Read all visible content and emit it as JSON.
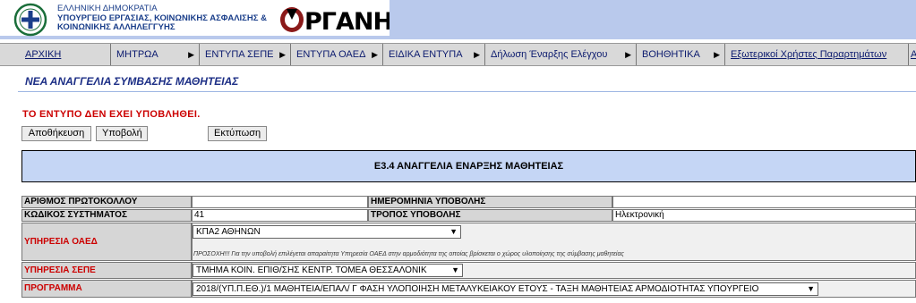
{
  "header": {
    "gov_line1": "ΕΛΛΗΝΙΚΗ ΔΗΜΟΚΡΑΤΙΑ",
    "gov_line2": "ΥΠΟΥΡΓΕΙΟ ΕΡΓΑΣΙΑΣ, ΚΟΙΝΩΝΙΚΗΣ ΑΣΦΑΛΙΣΗΣ &",
    "gov_line3": "ΚΟΙΝΩΝΙΚΗΣ ΑΛΛΗΛΕΓΓΥΗΣ",
    "app_logo": "ΕΡΓΑΝΗ"
  },
  "menu": {
    "items": [
      {
        "label": "ΑΡΧΙΚΗ",
        "arrow": ""
      },
      {
        "label": "ΜΗΤΡΩΑ",
        "arrow": "▶"
      },
      {
        "label": "ΕΝΤΥΠΑ ΣΕΠΕ",
        "arrow": "▶"
      },
      {
        "label": "ΕΝΤΥΠΑ ΟΑΕΔ",
        "arrow": "▶"
      },
      {
        "label": "ΕΙΔΙΚΑ ΕΝΤΥΠΑ",
        "arrow": "▶"
      },
      {
        "label": "Δήλωση Έναρξης Ελέγχου",
        "arrow": "▶"
      },
      {
        "label": "ΒΟΗΘΗΤΙΚΑ",
        "arrow": "▶"
      },
      {
        "label": "Εξωτερικοί Χρήστες Παραρτημάτων",
        "arrow": ""
      },
      {
        "label": "Α",
        "arrow": ""
      }
    ]
  },
  "page": {
    "subtitle": "ΝΕΑ ΑΝΑΓΓΕΛΙΑ ΣΥΜΒΑΣΗΣ ΜΑΘΗΤΕΙΑΣ",
    "warning": "ΤΟ ΕΝΤΥΠΟ ΔΕΝ ΕΧΕΙ ΥΠΟΒΛΗΘΕΙ."
  },
  "buttons": {
    "save": "Αποθήκευση",
    "submit": "Υποβολή",
    "print": "Εκτύπωση"
  },
  "form": {
    "title": "Ε3.4 ΑΝΑΓΓΕΛΙΑ ΕΝΑΡΞΗΣ ΜΑΘΗΤΕΙΑΣ",
    "protocol_label": "ΑΡΙΘΜΟΣ ΠΡΩΤΟΚΟΛΛΟΥ",
    "protocol_value": "",
    "submission_date_label": "ΗΜΕΡΟΜΗΝΙΑ ΥΠΟΒΟΛΗΣ",
    "submission_date_value": "",
    "system_code_label": "ΚΩΔΙΚΟΣ ΣΥΣΤΗΜΑΤΟΣ",
    "system_code_value": "41",
    "submission_method_label": "ΤΡΟΠΟΣ ΥΠΟΒΟΛΗΣ",
    "submission_method_value": "Ηλεκτρονική",
    "oaed_label": "ΥΠΗΡΕΣΙΑ ΟΑΕΔ",
    "oaed_value": "ΚΠΑ2 ΑΘΗΝΩΝ",
    "oaed_note": "ΠΡΟΣΟΧΗ!!! Για την υποβολή επιλέγεται απαραίτητα Υπηρεσία ΟΑΕΔ στην αρμοδιότητα της οποίας βρίσκεται ο χώρος υλοποίησης της σύμβασης μαθητείας",
    "sepe_label": "ΥΠΗΡΕΣΙΑ ΣΕΠΕ",
    "sepe_value": "ΤΜΗΜΑ ΚΟΙΝ. ΕΠΙΘ/ΣΗΣ ΚΕΝΤΡ. ΤΟΜΕΑ ΘΕΣΣΑΛΟΝΙΚ",
    "program_label": "ΠΡΟΓΡΑΜΜΑ",
    "program_value": "2018/(ΥΠ.Π.ΕΘ.)/1 ΜΑΘΗΤΕΙΑ/ΕΠΑΛ/ Γ ΦΑΣΗ ΥΛΟΠΟΙΗΣΗ ΜΕΤΑΛΥΚΕΙΑΚΟΥ ΕΤΟΥΣ - ΤΑΞΗ ΜΑΘΗΤΕΙΑΣ ΑΡΜΟΔΙΟΤΗΤΑΣ ΥΠΟΥΡΓΕΙΟ",
    "dropdown_arrow": "▼"
  }
}
